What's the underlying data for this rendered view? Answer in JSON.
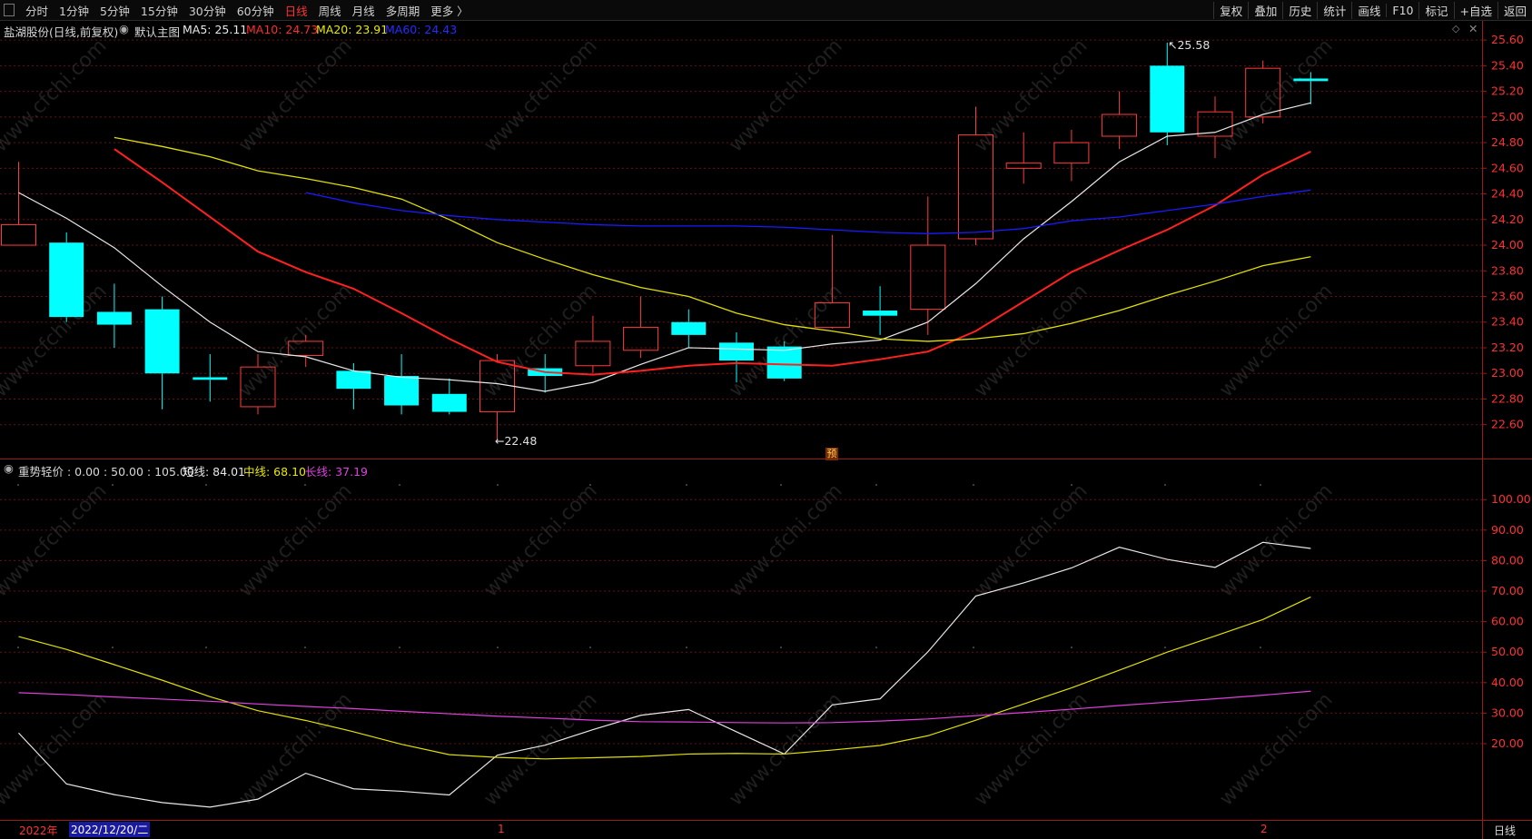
{
  "toolbar": {
    "periods": [
      "分时",
      "1分钟",
      "5分钟",
      "15分钟",
      "30分钟",
      "60分钟",
      "日线",
      "周线",
      "月线",
      "多周期",
      "更多 〉"
    ],
    "active_index": 6,
    "right": [
      "复权",
      "叠加",
      "历史",
      "统计",
      "画线",
      "F10",
      "标记",
      "+自选",
      "返回"
    ]
  },
  "main_header": {
    "title": "盐湖股份(日线,前复权)",
    "template": "默认主图",
    "ma5": "MA5: 25.11",
    "ma10": "MA10: 24.73",
    "ma20": "MA20: 23.91",
    "ma60": "MA60: 24.43"
  },
  "sub_header": {
    "title": "重势轻价 : 0.00 : 50.00 : 105.00",
    "short": "短线: 84.01",
    "mid": "中线: 68.10",
    "long": "长线: 37.19"
  },
  "annotations": {
    "high": "25.58",
    "low": "22.48",
    "forecast": "预"
  },
  "bottom": {
    "year": "2022年",
    "cursor_date": "2022/12/20/二",
    "jan": "1",
    "feb": "2",
    "period": "日线"
  },
  "watermark": "www.cfchi.com",
  "colors": {
    "up": "#ff3b3b",
    "down": "#00ffff",
    "ma5": "#e8e8e8",
    "ma10": "#ff2020",
    "ma20": "#e0e000",
    "ma60": "#1a1aff",
    "long": "#e040e0",
    "grid": "#6a1010"
  },
  "chart_data": [
    {
      "type": "candlestick",
      "y_ticks": [
        "25.60",
        "25.40",
        "25.20",
        "25.00",
        "24.80",
        "24.60",
        "24.40",
        "24.20",
        "24.00",
        "23.80",
        "23.60",
        "23.40",
        "23.20",
        "23.00",
        "22.80",
        "22.60"
      ],
      "ylim": [
        22.35,
        25.7
      ],
      "candles": [
        {
          "o": 24.0,
          "h": 24.65,
          "l": 24.0,
          "c": 24.16
        },
        {
          "o": 24.02,
          "h": 24.1,
          "l": 23.4,
          "c": 23.44
        },
        {
          "o": 23.48,
          "h": 23.7,
          "l": 23.2,
          "c": 23.38
        },
        {
          "o": 23.5,
          "h": 23.6,
          "l": 22.72,
          "c": 23.0
        },
        {
          "o": 22.97,
          "h": 23.15,
          "l": 22.78,
          "c": 22.95
        },
        {
          "o": 22.74,
          "h": 23.15,
          "l": 22.68,
          "c": 23.05
        },
        {
          "o": 23.14,
          "h": 23.3,
          "l": 23.05,
          "c": 23.25
        },
        {
          "o": 23.02,
          "h": 23.08,
          "l": 22.72,
          "c": 22.88
        },
        {
          "o": 22.98,
          "h": 23.15,
          "l": 22.68,
          "c": 22.75
        },
        {
          "o": 22.84,
          "h": 22.96,
          "l": 22.68,
          "c": 22.7
        },
        {
          "o": 22.7,
          "h": 23.15,
          "l": 22.48,
          "c": 23.1
        },
        {
          "o": 23.04,
          "h": 23.15,
          "l": 22.85,
          "c": 22.98
        },
        {
          "o": 23.06,
          "h": 23.45,
          "l": 23.0,
          "c": 23.25
        },
        {
          "o": 23.18,
          "h": 23.6,
          "l": 23.12,
          "c": 23.36
        },
        {
          "o": 23.4,
          "h": 23.5,
          "l": 23.2,
          "c": 23.3
        },
        {
          "o": 23.24,
          "h": 23.32,
          "l": 22.93,
          "c": 23.1
        },
        {
          "o": 23.21,
          "h": 23.25,
          "l": 22.94,
          "c": 22.96
        },
        {
          "o": 23.36,
          "h": 24.08,
          "l": 23.35,
          "c": 23.55
        },
        {
          "o": 23.49,
          "h": 23.68,
          "l": 23.3,
          "c": 23.45
        },
        {
          "o": 23.5,
          "h": 24.38,
          "l": 23.3,
          "c": 24.0
        },
        {
          "o": 24.05,
          "h": 25.08,
          "l": 24.0,
          "c": 24.86
        },
        {
          "o": 24.6,
          "h": 24.88,
          "l": 24.48,
          "c": 24.64
        },
        {
          "o": 24.64,
          "h": 24.9,
          "l": 24.5,
          "c": 24.8
        },
        {
          "o": 24.85,
          "h": 25.2,
          "l": 24.75,
          "c": 25.02
        },
        {
          "o": 25.4,
          "h": 25.58,
          "l": 24.78,
          "c": 24.88
        },
        {
          "o": 24.85,
          "h": 25.16,
          "l": 24.68,
          "c": 25.04
        },
        {
          "o": 25.0,
          "h": 25.44,
          "l": 24.95,
          "c": 25.38
        },
        {
          "o": 25.3,
          "h": 25.35,
          "l": 25.1,
          "c": 25.28
        }
      ],
      "series": [
        {
          "name": "MA5",
          "values": [
            24.41,
            24.21,
            23.98,
            23.68,
            23.4,
            23.17,
            23.13,
            23.02,
            22.97,
            22.95,
            22.92,
            22.86,
            22.93,
            23.07,
            23.2,
            23.19,
            23.18,
            23.23,
            23.26,
            23.4,
            23.7,
            24.05,
            24.34,
            24.65,
            24.85,
            24.88,
            25.02,
            25.11
          ]
        },
        {
          "name": "MA10",
          "values": [
            24.75,
            24.49,
            24.22,
            23.95,
            23.79,
            23.66,
            23.47,
            23.27,
            23.09,
            23.01,
            22.99,
            23.02,
            23.06,
            23.08,
            23.07,
            23.06,
            23.11,
            23.17,
            23.33,
            23.56,
            23.79,
            23.96,
            24.12,
            24.31,
            24.55,
            24.73
          ]
        },
        {
          "name": "MA20",
          "values": [
            24.84,
            24.77,
            24.69,
            24.58,
            24.52,
            24.45,
            24.36,
            24.2,
            24.02,
            23.89,
            23.77,
            23.67,
            23.6,
            23.47,
            23.38,
            23.33,
            23.27,
            23.25,
            23.27,
            23.31,
            23.39,
            23.49,
            23.61,
            23.72,
            23.84,
            23.91
          ]
        },
        {
          "name": "MA60",
          "values": [
            24.41,
            24.33,
            24.27,
            24.23,
            24.2,
            24.18,
            24.16,
            24.15,
            24.15,
            24.15,
            24.14,
            24.12,
            24.1,
            24.09,
            24.1,
            24.13,
            24.19,
            24.22,
            24.27,
            24.32,
            24.38,
            24.43
          ]
        }
      ]
    },
    {
      "type": "line",
      "y_ticks": [
        "100.00",
        "90.00",
        "80.00",
        "70.00",
        "60.00",
        "50.00",
        "40.00",
        "30.00",
        "20.00"
      ],
      "ylim": [
        -5,
        109
      ],
      "series": [
        {
          "name": "短线",
          "values": [
            23.5,
            6.8,
            3.3,
            0.7,
            -0.8,
            1.8,
            10.3,
            5.2,
            4.4,
            3.2,
            16.2,
            19.5,
            24.6,
            29.3,
            31.2,
            23.9,
            16.6,
            32.7,
            34.7,
            50.1,
            68.4,
            72.7,
            77.6,
            84.4,
            80.4,
            77.8,
            86.0,
            84.0
          ]
        },
        {
          "name": "中线",
          "values": [
            55.1,
            50.9,
            45.9,
            40.8,
            35.4,
            30.8,
            27.6,
            23.9,
            19.8,
            16.4,
            15.5,
            15.0,
            15.4,
            15.8,
            16.6,
            16.8,
            16.6,
            17.9,
            19.4,
            22.6,
            27.7,
            33.0,
            38.3,
            44.1,
            50.0,
            55.3,
            60.7,
            68.1
          ]
        },
        {
          "name": "长线",
          "values": [
            36.7,
            36.1,
            35.3,
            34.6,
            33.9,
            33.0,
            32.2,
            31.5,
            30.6,
            29.8,
            29.0,
            28.4,
            27.7,
            27.2,
            27.1,
            26.9,
            26.8,
            26.9,
            27.4,
            28.1,
            29.2,
            30.2,
            31.3,
            32.5,
            33.6,
            34.7,
            35.9,
            37.2
          ]
        }
      ]
    }
  ]
}
